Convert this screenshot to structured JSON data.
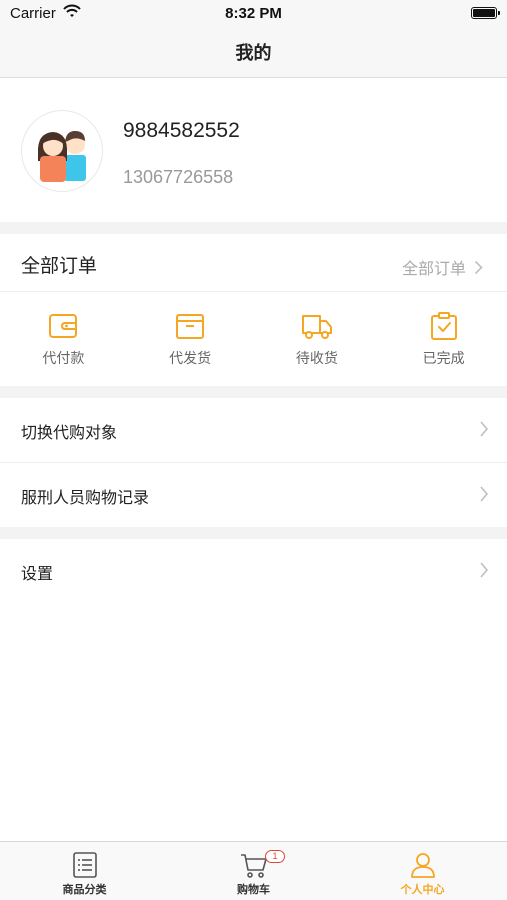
{
  "status_bar": {
    "carrier": "Carrier",
    "time": "8:32 PM"
  },
  "nav": {
    "title": "我的"
  },
  "profile": {
    "name": "9884582552",
    "phone": "13067726558"
  },
  "orders": {
    "header_label": "全部订单",
    "all_link": "全部订单",
    "items": [
      {
        "label": "代付款",
        "icon": "wallet-icon"
      },
      {
        "label": "代发货",
        "icon": "box-icon"
      },
      {
        "label": "待收货",
        "icon": "truck-icon"
      },
      {
        "label": "已完成",
        "icon": "clipboard-check-icon"
      }
    ]
  },
  "menu": {
    "switch_proxy": "切换代购对象",
    "inmate_records": "服刑人员购物记录",
    "settings": "设置"
  },
  "tabbar": {
    "items": [
      {
        "label": "商品分类",
        "icon": "list-icon"
      },
      {
        "label": "购物车",
        "icon": "cart-icon",
        "badge": "1"
      },
      {
        "label": "个人中心",
        "icon": "person-icon"
      }
    ]
  },
  "colors": {
    "accent": "#f5a623",
    "badge": "#e0453a",
    "section_gap": "#f3f3f3"
  }
}
